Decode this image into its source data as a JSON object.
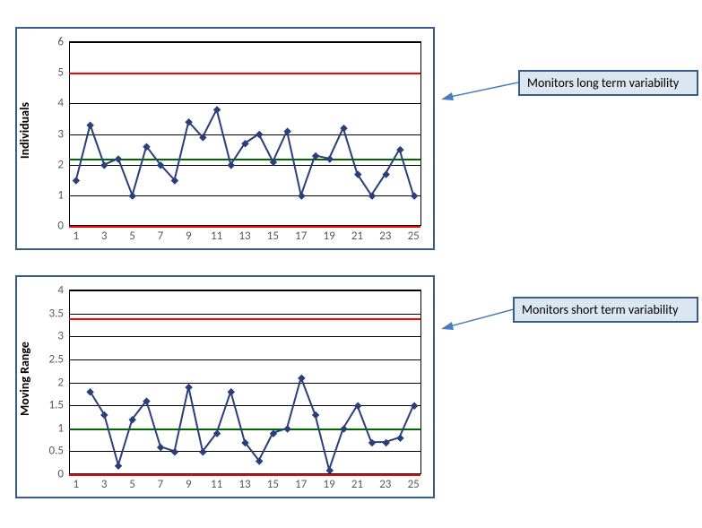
{
  "chart_data": [
    {
      "type": "line",
      "name": "individuals",
      "title": "",
      "xlabel": "",
      "ylabel": "Individuals",
      "x": [
        1,
        2,
        3,
        4,
        5,
        6,
        7,
        8,
        9,
        10,
        11,
        12,
        13,
        14,
        15,
        16,
        17,
        18,
        19,
        20,
        21,
        22,
        23,
        24,
        25
      ],
      "ylim": [
        0,
        6
      ],
      "yticks": [
        0,
        1,
        2,
        3,
        4,
        5,
        6
      ],
      "xticks": [
        1,
        3,
        5,
        7,
        9,
        11,
        13,
        15,
        17,
        19,
        21,
        23,
        25
      ],
      "reference_lines": {
        "centerline": 2.2,
        "ucl": 5.0,
        "lcl": 0.0
      },
      "series": [
        {
          "name": "Individuals",
          "values": [
            1.5,
            3.3,
            2.0,
            2.2,
            1.0,
            2.6,
            2.0,
            1.5,
            3.4,
            2.9,
            3.8,
            2.0,
            2.7,
            3.0,
            2.1,
            3.1,
            1.0,
            2.3,
            2.2,
            3.2,
            1.7,
            1.0,
            1.7,
            2.5,
            1.0
          ]
        }
      ]
    },
    {
      "type": "line",
      "name": "moving_range",
      "title": "",
      "xlabel": "",
      "ylabel": "Moving Range",
      "x": [
        1,
        2,
        3,
        4,
        5,
        6,
        7,
        8,
        9,
        10,
        11,
        12,
        13,
        14,
        15,
        16,
        17,
        18,
        19,
        20,
        21,
        22,
        23,
        24,
        25
      ],
      "ylim": [
        0,
        4
      ],
      "yticks": [
        0,
        0.5,
        1.0,
        1.5,
        2.0,
        2.5,
        3.0,
        3.5,
        4.0
      ],
      "xticks": [
        1,
        3,
        5,
        7,
        9,
        11,
        13,
        15,
        17,
        19,
        21,
        23,
        25
      ],
      "reference_lines": {
        "centerline": 1.0,
        "ucl": 3.4,
        "lcl": 0.0
      },
      "series": [
        {
          "name": "Moving Range",
          "values": [
            null,
            1.8,
            1.3,
            0.2,
            1.2,
            1.6,
            0.6,
            0.5,
            1.9,
            0.5,
            0.9,
            1.8,
            0.7,
            0.3,
            0.9,
            1.0,
            2.1,
            1.3,
            0.1,
            1.0,
            1.5,
            0.7,
            0.7,
            0.8,
            1.5
          ]
        }
      ]
    }
  ],
  "callouts": {
    "long_term": "Monitors long term variability",
    "short_term": "Monitors short term variability"
  }
}
